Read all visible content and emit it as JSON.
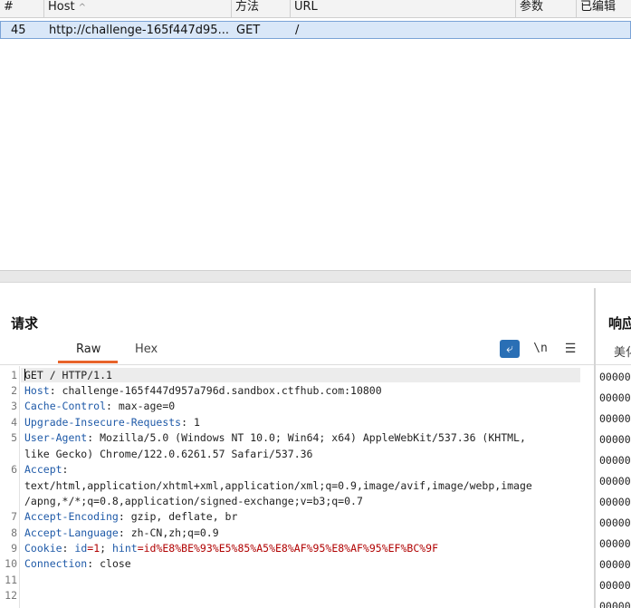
{
  "history_table": {
    "columns": [
      {
        "key": "num",
        "label": "#"
      },
      {
        "key": "host",
        "label": "Host",
        "sort_icon": "^"
      },
      {
        "key": "method",
        "label": "方法"
      },
      {
        "key": "url",
        "label": "URL"
      },
      {
        "key": "params",
        "label": "参数"
      },
      {
        "key": "edited",
        "label": "已编辑"
      }
    ],
    "selected_row": {
      "num": "45",
      "host": "http://challenge-165f447d95...",
      "method": "GET",
      "url": "/"
    }
  },
  "request_panel": {
    "title": "请求",
    "tabs": [
      "Raw",
      "Hex"
    ],
    "active_tab": "Raw",
    "tools": {
      "wrap": "⤶",
      "newline": "\\n",
      "menu": "☰"
    },
    "line_numbers": [
      "1",
      "2",
      "3",
      "4",
      "5",
      "",
      "6",
      "",
      "",
      "7",
      "8",
      "9",
      "10",
      "11",
      "12"
    ],
    "lines": [
      {
        "name": "",
        "value": "GET / HTTP/1.1"
      },
      {
        "name": "Host",
        "value": ": challenge-165f447d957a796d.sandbox.ctfhub.com:10800"
      },
      {
        "name": "Cache-Control",
        "value": ": max-age=0"
      },
      {
        "name": "Upgrade-Insecure-Requests",
        "value": ": 1"
      },
      {
        "name": "User-Agent",
        "value": ": Mozilla/5.0 (Windows NT 10.0; Win64; x64) AppleWebKit/537.36 (KHTML,"
      },
      {
        "name": "",
        "value": "like Gecko) Chrome/122.0.6261.57 Safari/537.36"
      },
      {
        "name": "Accept",
        "value": ":"
      },
      {
        "name": "",
        "value": "text/html,application/xhtml+xml,application/xml;q=0.9,image/avif,image/webp,image"
      },
      {
        "name": "",
        "value": "/apng,*/*;q=0.8,application/signed-exchange;v=b3;q=0.7"
      },
      {
        "name": "Accept-Encoding",
        "value": ": gzip, deflate, br"
      },
      {
        "name": "Accept-Language",
        "value": ": zh-CN,zh;q=0.9"
      }
    ],
    "cookie_line": {
      "name": "Cookie",
      "sep": ": ",
      "k1": "id",
      "v1": "=1",
      "sep2": "; ",
      "k2": "hint",
      "v2": "=id%E8%BE%93%E5%85%A5%E8%AF%95%E8%AF%95%EF%BC%9F"
    },
    "connection_line": {
      "name": "Connection",
      "value": ": close"
    }
  },
  "response_panel": {
    "title": "响应",
    "tab": "美化",
    "hex_rows": [
      "00000",
      "00000",
      "00000",
      "00000",
      "00000",
      "00000",
      "00000",
      "00000",
      "00000",
      "00000",
      "00000",
      "00000"
    ]
  }
}
